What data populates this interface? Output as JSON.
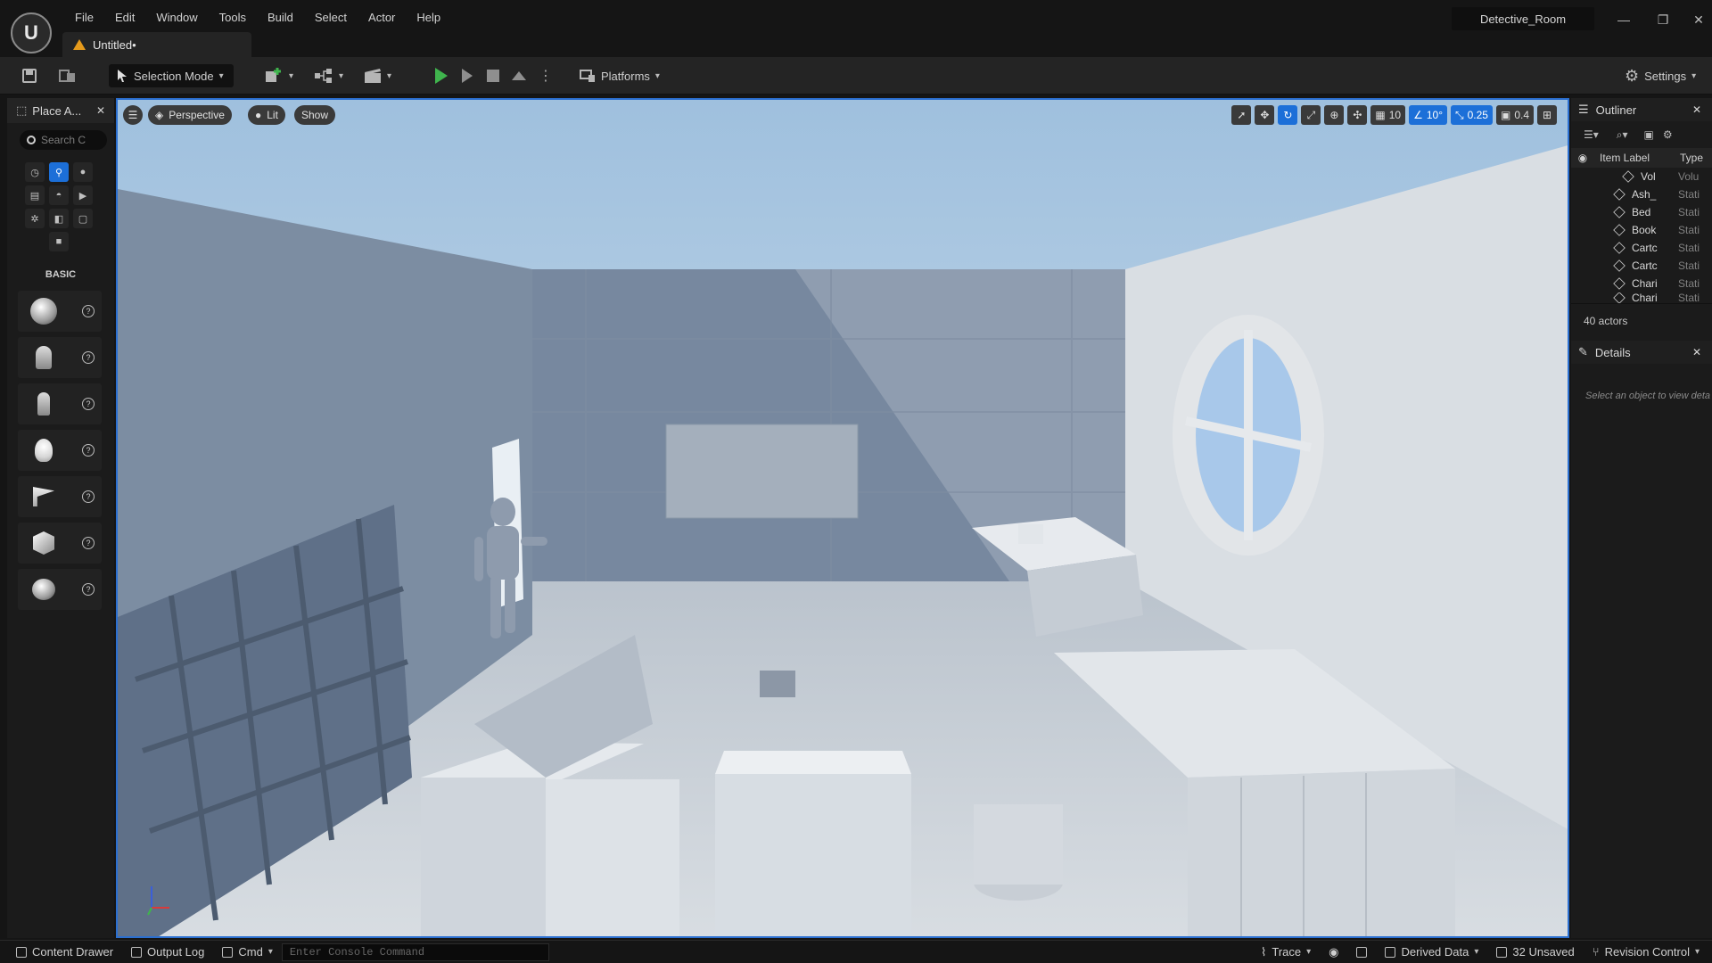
{
  "menu": [
    "File",
    "Edit",
    "Window",
    "Tools",
    "Build",
    "Select",
    "Actor",
    "Help"
  ],
  "project_name": "Detective_Room",
  "document_tab": "Untitled•",
  "toolbar": {
    "selection_mode": "Selection Mode",
    "platforms": "Platforms",
    "settings": "Settings"
  },
  "place_actors": {
    "title": "Place A...",
    "search_placeholder": "Search C",
    "section": "BASIC",
    "help_glyph": "?"
  },
  "viewport": {
    "perspective": "Perspective",
    "lit": "Lit",
    "show": "Show",
    "grid_snap": "10",
    "rot_snap": "10°",
    "scale_snap": "0.25",
    "cam_speed": "0.4"
  },
  "outliner": {
    "title": "Outliner",
    "col_label": "Item Label",
    "col_type": "Type",
    "rows": [
      {
        "label": "Vol",
        "type": "Volu"
      },
      {
        "label": "Ash_",
        "type": "Stati"
      },
      {
        "label": "Bed",
        "type": "Stati"
      },
      {
        "label": "Book",
        "type": "Stati"
      },
      {
        "label": "Cartc",
        "type": "Stati"
      },
      {
        "label": "Cartc",
        "type": "Stati"
      },
      {
        "label": "Chari",
        "type": "Stati"
      },
      {
        "label": "Chari",
        "type": "Stati"
      }
    ],
    "count": "40 actors"
  },
  "details": {
    "title": "Details",
    "hint": "Select an object to view deta"
  },
  "statusbar": {
    "content_drawer": "Content Drawer",
    "output_log": "Output Log",
    "cmd": "Cmd",
    "console_placeholder": "Enter Console Command",
    "trace": "Trace",
    "derived_data": "Derived Data",
    "unsaved": "32 Unsaved",
    "revision_control": "Revision Control"
  },
  "colors": {
    "accent": "#1c6fd8",
    "play_green": "#3fb44d",
    "warning": "#e59a1c"
  }
}
